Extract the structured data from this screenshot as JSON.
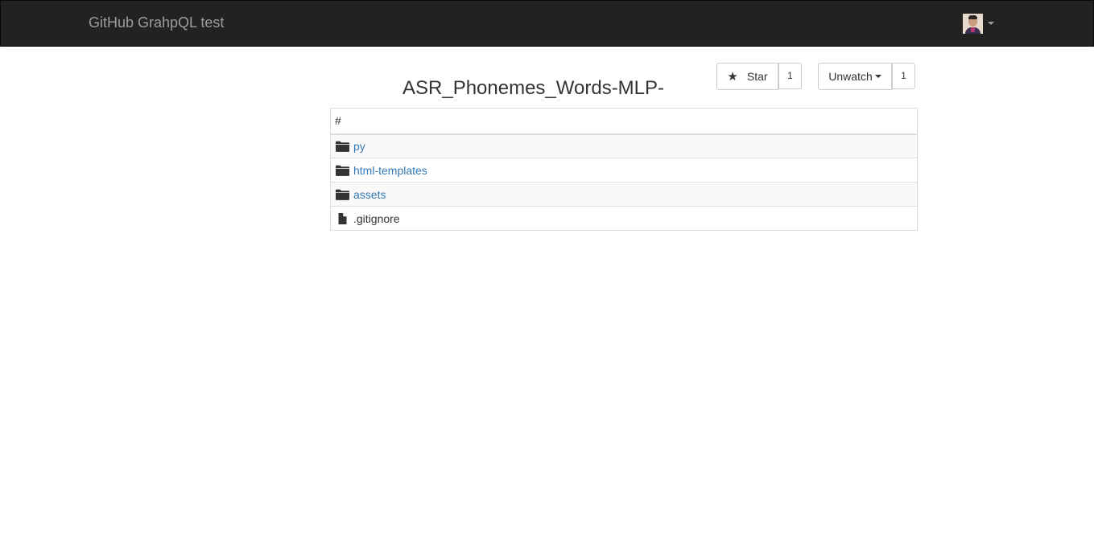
{
  "navbar": {
    "brand": "GitHub GrahpQL test"
  },
  "repo": {
    "title": "ASR_Phonemes_Words-MLP-",
    "star_label": "Star",
    "star_count": "1",
    "watch_label": "Unwatch",
    "watch_count": "1"
  },
  "table": {
    "header": "#",
    "rows": [
      {
        "name": "py",
        "kind": "folder",
        "icon": "folder-icon"
      },
      {
        "name": "html-templates",
        "kind": "folder",
        "icon": "folder-icon"
      },
      {
        "name": "assets",
        "kind": "folder",
        "icon": "folder-icon"
      },
      {
        "name": ".gitignore",
        "kind": "file",
        "icon": "file-icon"
      }
    ]
  },
  "colors": {
    "navbar_bg": "#222222",
    "brand_text": "#9d9d9d",
    "link": "#337ab7",
    "stripe": "#f9f9f9",
    "border": "#dddddd"
  }
}
